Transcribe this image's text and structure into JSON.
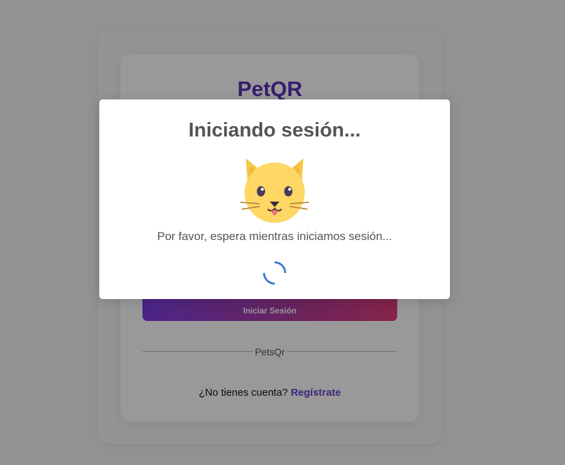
{
  "login": {
    "brand": "PetQR",
    "submit_label": "Iniciar Sesión",
    "divider_label": "PetsQr",
    "signup_prompt": "¿No tienes cuenta?",
    "signup_link": "Regístrate"
  },
  "modal": {
    "title": "Iniciando sesión...",
    "icon": "cat-face-icon",
    "message": "Por favor, espera mientras iniciamos sesión...",
    "spinner_color": "#3d7ad2"
  },
  "colors": {
    "brand": "#5a2fb9",
    "link": "#6a3fc8",
    "overlay": "rgba(0,0,0,0.4)"
  }
}
